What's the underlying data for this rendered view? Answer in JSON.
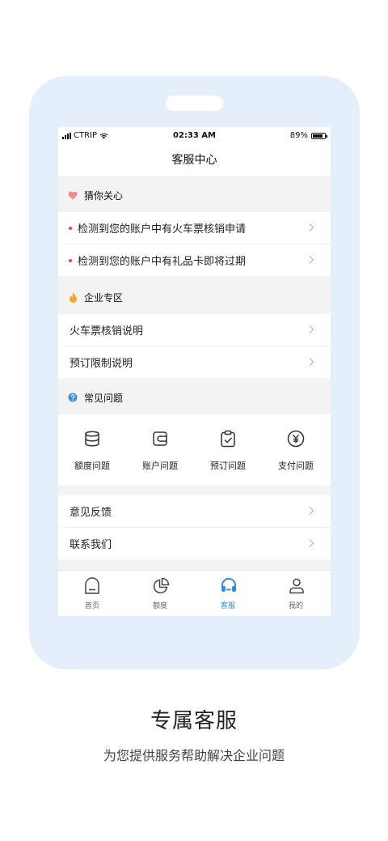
{
  "status_bar": {
    "carrier": "CTRIP",
    "time": "02:33 AM",
    "battery": "89%"
  },
  "nav": {
    "title": "客服中心"
  },
  "sections": {
    "guess": {
      "title": "猜你关心",
      "items": [
        {
          "label": "检测到您的账户中有火车票核销申请"
        },
        {
          "label": "检测到您的账户中有礼品卡即将过期"
        }
      ]
    },
    "enterprise": {
      "title": "企业专区",
      "items": [
        {
          "label": "火车票核销说明"
        },
        {
          "label": "预订限制说明"
        }
      ]
    },
    "faq": {
      "title": "常见问题",
      "categories": [
        {
          "label": "额度问题",
          "icon": "database-icon"
        },
        {
          "label": "账户问题",
          "icon": "wallet-icon"
        },
        {
          "label": "预订问题",
          "icon": "clipboard-check-icon"
        },
        {
          "label": "支付问题",
          "icon": "yen-circle-icon"
        }
      ]
    },
    "misc": {
      "items": [
        {
          "label": "意见反馈"
        },
        {
          "label": "联系我们"
        }
      ]
    }
  },
  "tabbar": {
    "items": [
      {
        "label": "首页",
        "icon": "home-icon",
        "active": false
      },
      {
        "label": "额度",
        "icon": "pie-chart-icon",
        "active": false
      },
      {
        "label": "客服",
        "icon": "headset-icon",
        "active": true
      },
      {
        "label": "我的",
        "icon": "user-icon",
        "active": false
      }
    ]
  },
  "caption": {
    "title": "专属客服",
    "subtitle": "为您提供服务帮助解决企业问题"
  },
  "colors": {
    "accent": "#2f8ae8",
    "frame": "#e5effb",
    "alert_dot": "#e8423a",
    "heart": "#f08a96",
    "fire": "#f5a623",
    "help": "#3d8fe0"
  }
}
